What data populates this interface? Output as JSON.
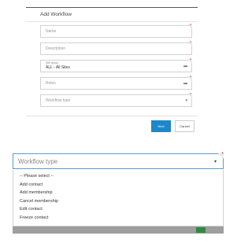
{
  "dialog": {
    "title": "Add Workflow",
    "fields": {
      "name": {
        "placeholder": "Name"
      },
      "description": {
        "placeholder": "Description"
      },
      "site_group": {
        "label": "Site group",
        "value": "ALL - All Sites",
        "caret": "▬"
      },
      "roles": {
        "placeholder": "Roles",
        "caret": "▬"
      },
      "workflow_type": {
        "placeholder": "Workflow type",
        "caret": "▾"
      }
    },
    "required_marker": "*",
    "buttons": {
      "next": "Next",
      "cancel": "Cancel"
    },
    "accent_color": "#1f86c9"
  },
  "dropdown": {
    "placeholder": "Workflow type",
    "caret": "▾",
    "required_marker": "*",
    "options": [
      "-- Please select --",
      "Add contact",
      "Add membership",
      "Cancel membership",
      "Edit contact",
      "Freeze contact"
    ]
  }
}
